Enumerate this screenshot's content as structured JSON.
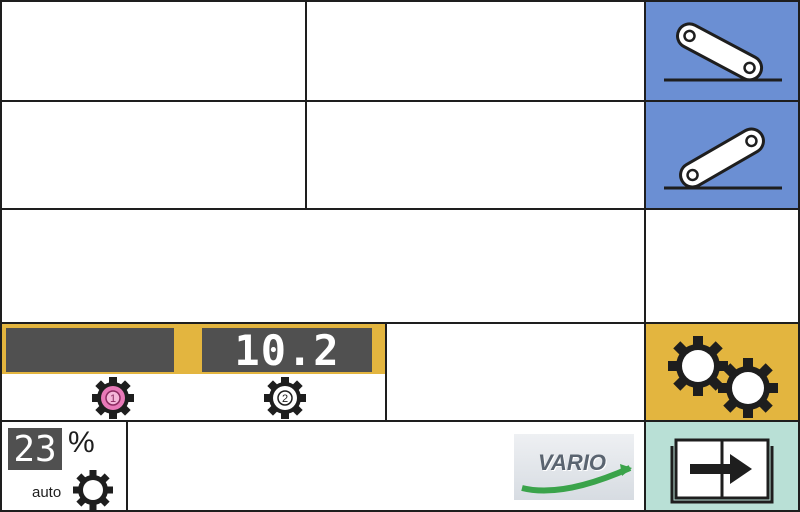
{
  "gear_panel": {
    "gear1_value": "",
    "gear2_value": "10.2",
    "gear1_number": "1",
    "gear2_number": "2"
  },
  "percent_panel": {
    "value": "23",
    "unit": "%",
    "mode_label": "auto"
  },
  "logo": {
    "text": "VARIO"
  },
  "colors": {
    "blue_button": "#6b8fd3",
    "gold_panel": "#e3b53f",
    "mint_button": "#b9e0d6",
    "display_bg": "#505050",
    "gear1_active": "#e879b8"
  },
  "icons": {
    "button_top": "hitch-raise-icon",
    "button_second": "hitch-lower-icon",
    "button_gears": "gears-settings-icon",
    "button_book": "book-next-icon"
  }
}
